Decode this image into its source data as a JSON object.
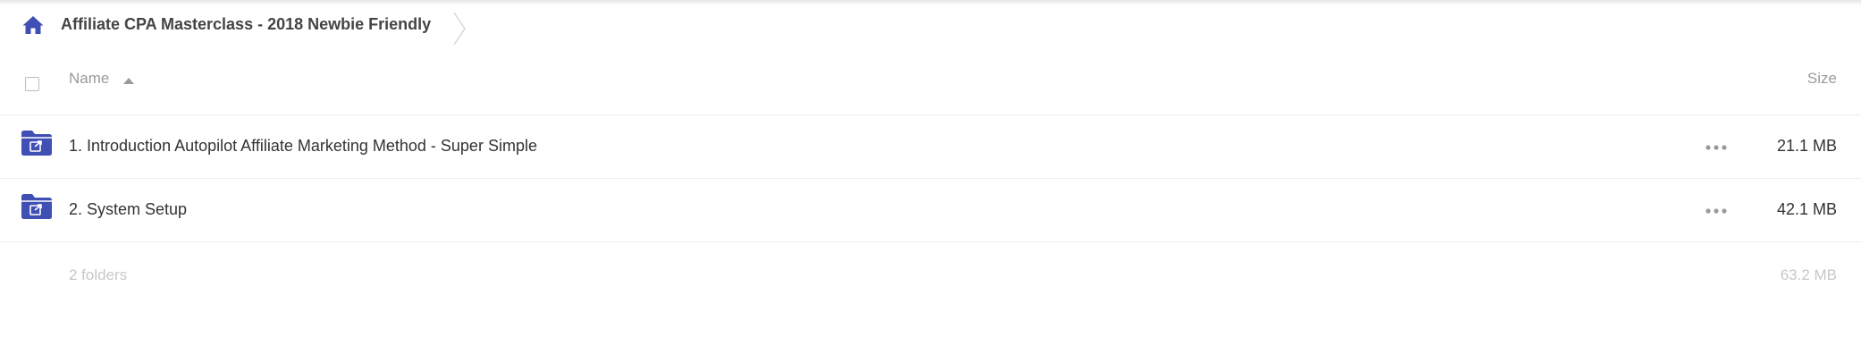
{
  "breadcrumb": {
    "home_icon": "home-icon",
    "title": "Affiliate CPA Masterclass - 2018 Newbie Friendly"
  },
  "table": {
    "columns": {
      "name": "Name",
      "size": "Size",
      "sort": "ascending"
    },
    "rows": [
      {
        "icon": "shared-folder-icon",
        "name": "1. Introduction Autopilot Affiliate Marketing Method - Super Simple",
        "size": "21.1 MB"
      },
      {
        "icon": "shared-folder-icon",
        "name": "2. System Setup",
        "size": "42.1 MB"
      }
    ],
    "footer": {
      "count": "2 folders",
      "total": "63.2 MB"
    }
  },
  "colors": {
    "accent": "#3f4fb3",
    "text": "#333333",
    "muted": "#9a9a9a",
    "faint": "#c8c8c8",
    "divider": "#ececec"
  }
}
